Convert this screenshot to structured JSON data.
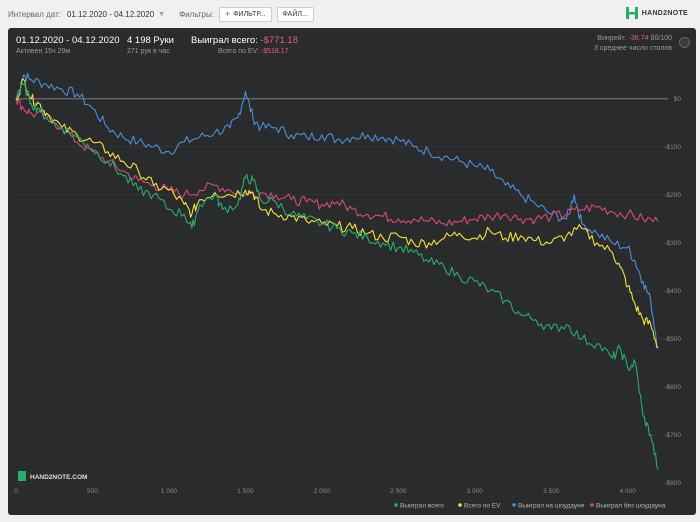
{
  "toolbar": {
    "interval_label": "Интервал дат:",
    "date_range": "01.12.2020 - 04.12.2020",
    "filters_label": "Фильтры:",
    "filter_button": "ФИЛЬТР...",
    "file_button": "ФАЙЛ..."
  },
  "logo": {
    "text": "HAND2NOTE"
  },
  "header": {
    "range": "01.12.2020 - 04.12.2020",
    "active": "Активен 15ч 29м",
    "hands": "4 198 Руки",
    "rate": "271 рук в час",
    "won_label": "Выиграл всего:",
    "won_value": "-$771.18",
    "ev_label": "Всего по EV:",
    "ev_value": "-$518.17",
    "vpip_label": "Винрейт:",
    "vpip_value": "-36.74",
    "vpip_suffix": "бб/100",
    "tables": "3 среднее число столов"
  },
  "watermark": "HAND2NOTE.COM",
  "colors": {
    "total": "#2aad6a",
    "ev": "#f2e23a",
    "showdown": "#4a8fd8",
    "nonshowdown": "#d8487a",
    "zero_line": "#8a8a8a",
    "grid": "#3a3b3d",
    "panel": "#2a2b2d"
  },
  "chart_data": {
    "type": "line",
    "x_ticks": [
      "0",
      "500",
      "1 000",
      "1 500",
      "2 000",
      "2 500",
      "3 000",
      "3 500",
      "4 000"
    ],
    "y_ticks": [
      "$0",
      "-$100",
      "-$200",
      "-$300",
      "-$400",
      "-$500",
      "-$600",
      "-$700",
      "-$800"
    ],
    "xlim": [
      0,
      4198
    ],
    "ylim": [
      -800,
      60
    ],
    "series": [
      {
        "name": "Выиграл всего",
        "color_key": "total",
        "points": [
          [
            0,
            0
          ],
          [
            50,
            30
          ],
          [
            100,
            -10
          ],
          [
            150,
            -20
          ],
          [
            200,
            -40
          ],
          [
            300,
            -60
          ],
          [
            400,
            -80
          ],
          [
            500,
            -105
          ],
          [
            600,
            -130
          ],
          [
            700,
            -160
          ],
          [
            800,
            -190
          ],
          [
            900,
            -200
          ],
          [
            1000,
            -230
          ],
          [
            1100,
            -240
          ],
          [
            1150,
            -270
          ],
          [
            1200,
            -220
          ],
          [
            1300,
            -200
          ],
          [
            1350,
            -230
          ],
          [
            1450,
            -220
          ],
          [
            1500,
            -165
          ],
          [
            1550,
            -170
          ],
          [
            1600,
            -210
          ],
          [
            1700,
            -215
          ],
          [
            1800,
            -240
          ],
          [
            1900,
            -250
          ],
          [
            2000,
            -260
          ],
          [
            2100,
            -270
          ],
          [
            2200,
            -280
          ],
          [
            2300,
            -290
          ],
          [
            2400,
            -300
          ],
          [
            2500,
            -310
          ],
          [
            2600,
            -320
          ],
          [
            2700,
            -340
          ],
          [
            2800,
            -350
          ],
          [
            2900,
            -370
          ],
          [
            3000,
            -380
          ],
          [
            3100,
            -400
          ],
          [
            3200,
            -420
          ],
          [
            3300,
            -450
          ],
          [
            3400,
            -460
          ],
          [
            3500,
            -480
          ],
          [
            3600,
            -470
          ],
          [
            3700,
            -500
          ],
          [
            3800,
            -510
          ],
          [
            3900,
            -540
          ],
          [
            3950,
            -520
          ],
          [
            4000,
            -560
          ],
          [
            4050,
            -550
          ],
          [
            4100,
            -660
          ],
          [
            4150,
            -700
          ],
          [
            4198,
            -771
          ]
        ]
      },
      {
        "name": "Всего по EV",
        "color_key": "ev",
        "points": [
          [
            0,
            0
          ],
          [
            50,
            40
          ],
          [
            100,
            0
          ],
          [
            150,
            -10
          ],
          [
            200,
            -30
          ],
          [
            300,
            -60
          ],
          [
            400,
            -75
          ],
          [
            500,
            -90
          ],
          [
            600,
            -110
          ],
          [
            700,
            -130
          ],
          [
            800,
            -150
          ],
          [
            900,
            -180
          ],
          [
            1000,
            -190
          ],
          [
            1100,
            -220
          ],
          [
            1150,
            -240
          ],
          [
            1200,
            -210
          ],
          [
            1300,
            -195
          ],
          [
            1400,
            -200
          ],
          [
            1500,
            -190
          ],
          [
            1550,
            -195
          ],
          [
            1600,
            -230
          ],
          [
            1700,
            -240
          ],
          [
            1800,
            -245
          ],
          [
            1900,
            -255
          ],
          [
            2000,
            -260
          ],
          [
            2100,
            -265
          ],
          [
            2200,
            -270
          ],
          [
            2300,
            -280
          ],
          [
            2400,
            -290
          ],
          [
            2500,
            -285
          ],
          [
            2600,
            -300
          ],
          [
            2700,
            -300
          ],
          [
            2800,
            -290
          ],
          [
            2900,
            -280
          ],
          [
            3000,
            -290
          ],
          [
            3100,
            -275
          ],
          [
            3200,
            -290
          ],
          [
            3300,
            -285
          ],
          [
            3400,
            -295
          ],
          [
            3500,
            -300
          ],
          [
            3600,
            -285
          ],
          [
            3700,
            -270
          ],
          [
            3800,
            -300
          ],
          [
            3900,
            -320
          ],
          [
            3950,
            -350
          ],
          [
            4000,
            -390
          ],
          [
            4050,
            -430
          ],
          [
            4100,
            -460
          ],
          [
            4150,
            -470
          ],
          [
            4198,
            -518
          ]
        ]
      },
      {
        "name": "Выиграл на шоудауне",
        "color_key": "showdown",
        "points": [
          [
            0,
            0
          ],
          [
            50,
            50
          ],
          [
            100,
            40
          ],
          [
            200,
            30
          ],
          [
            300,
            20
          ],
          [
            400,
            10
          ],
          [
            500,
            -20
          ],
          [
            600,
            -60
          ],
          [
            700,
            -80
          ],
          [
            800,
            -90
          ],
          [
            900,
            -100
          ],
          [
            1000,
            -110
          ],
          [
            1100,
            -90
          ],
          [
            1200,
            -80
          ],
          [
            1300,
            -70
          ],
          [
            1400,
            -60
          ],
          [
            1450,
            -40
          ],
          [
            1500,
            15
          ],
          [
            1550,
            -40
          ],
          [
            1600,
            -60
          ],
          [
            1700,
            -60
          ],
          [
            1800,
            -75
          ],
          [
            1900,
            -80
          ],
          [
            2000,
            -75
          ],
          [
            2100,
            -85
          ],
          [
            2200,
            -80
          ],
          [
            2300,
            -75
          ],
          [
            2400,
            -80
          ],
          [
            2500,
            -85
          ],
          [
            2600,
            -100
          ],
          [
            2700,
            -110
          ],
          [
            2800,
            -120
          ],
          [
            2900,
            -130
          ],
          [
            3000,
            -140
          ],
          [
            3100,
            -150
          ],
          [
            3200,
            -180
          ],
          [
            3300,
            -200
          ],
          [
            3400,
            -220
          ],
          [
            3500,
            -240
          ],
          [
            3600,
            -250
          ],
          [
            3650,
            -200
          ],
          [
            3700,
            -260
          ],
          [
            3800,
            -280
          ],
          [
            3900,
            -300
          ],
          [
            4000,
            -310
          ],
          [
            4050,
            -340
          ],
          [
            4100,
            -380
          ],
          [
            4150,
            -420
          ],
          [
            4198,
            -520
          ]
        ]
      },
      {
        "name": "Выиграл без шоудауна",
        "color_key": "nonshowdown",
        "points": [
          [
            0,
            0
          ],
          [
            50,
            -20
          ],
          [
            100,
            -30
          ],
          [
            200,
            -40
          ],
          [
            300,
            -60
          ],
          [
            400,
            -90
          ],
          [
            500,
            -110
          ],
          [
            600,
            -130
          ],
          [
            700,
            -150
          ],
          [
            800,
            -170
          ],
          [
            900,
            -180
          ],
          [
            1000,
            -190
          ],
          [
            1100,
            -200
          ],
          [
            1200,
            -190
          ],
          [
            1300,
            -180
          ],
          [
            1400,
            -190
          ],
          [
            1500,
            -200
          ],
          [
            1600,
            -195
          ],
          [
            1700,
            -200
          ],
          [
            1800,
            -210
          ],
          [
            1900,
            -215
          ],
          [
            2000,
            -220
          ],
          [
            2100,
            -215
          ],
          [
            2200,
            -230
          ],
          [
            2300,
            -240
          ],
          [
            2400,
            -245
          ],
          [
            2500,
            -250
          ],
          [
            2600,
            -250
          ],
          [
            2700,
            -255
          ],
          [
            2800,
            -260
          ],
          [
            2900,
            -255
          ],
          [
            3000,
            -250
          ],
          [
            3100,
            -245
          ],
          [
            3200,
            -240
          ],
          [
            3300,
            -250
          ],
          [
            3400,
            -250
          ],
          [
            3500,
            -245
          ],
          [
            3600,
            -240
          ],
          [
            3700,
            -230
          ],
          [
            3800,
            -225
          ],
          [
            3900,
            -235
          ],
          [
            4000,
            -240
          ],
          [
            4100,
            -250
          ],
          [
            4198,
            -255
          ]
        ]
      }
    ]
  }
}
